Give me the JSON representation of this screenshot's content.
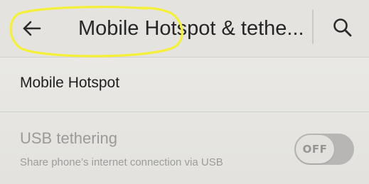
{
  "appbar": {
    "title": "Mobile Hotspot & tethe...",
    "back_icon": "arrow-left-icon",
    "search_icon": "search-icon"
  },
  "rows": {
    "hotspot": {
      "label": "Mobile Hotspot"
    },
    "usb": {
      "title": "USB tethering",
      "subtitle": "Share phone’s internet connection via USB",
      "toggle_state": "OFF"
    }
  },
  "colors": {
    "highlight": "#f4f03a",
    "background": "#e9e8e4",
    "disabled_text": "#9a9a98"
  }
}
